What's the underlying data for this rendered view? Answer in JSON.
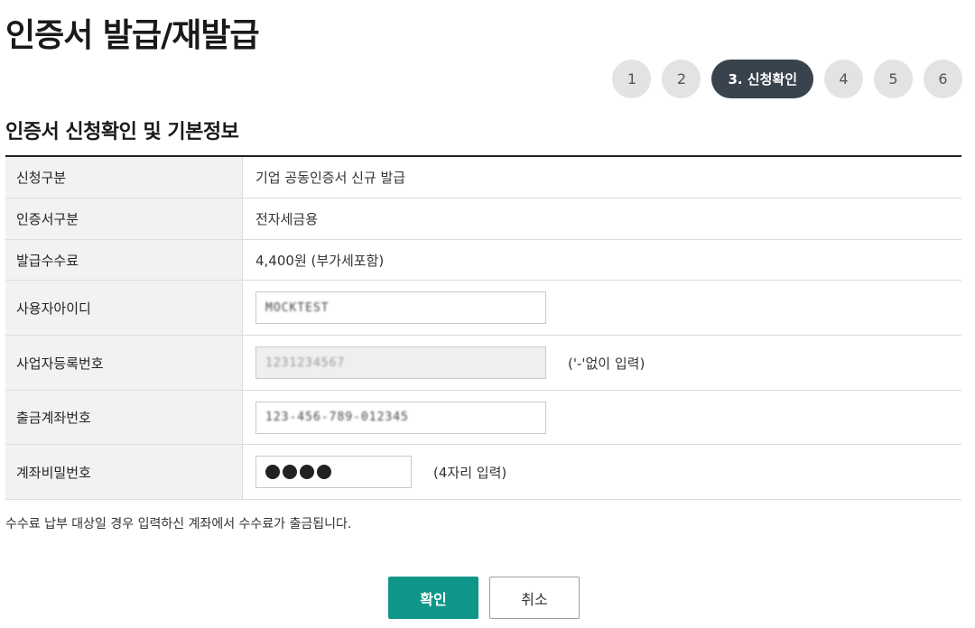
{
  "page": {
    "title": "인증서 발급/재발급"
  },
  "steps": [
    {
      "label": "1"
    },
    {
      "label": "2"
    },
    {
      "label": "3. 신청확인"
    },
    {
      "label": "4"
    },
    {
      "label": "5"
    },
    {
      "label": "6"
    }
  ],
  "section": {
    "title": "인증서 신청확인 및 기본정보"
  },
  "form": {
    "rows": [
      {
        "label": "신청구분",
        "value": "기업 공동인증서 신규 발급"
      },
      {
        "label": "인증서구분",
        "value": "전자세금용"
      },
      {
        "label": "발급수수료",
        "value": "4,400원 (부가세포함)"
      },
      {
        "label": "사용자아이디",
        "value": "MOCKTEST"
      },
      {
        "label": "사업자등록번호",
        "value": "1231234567",
        "hint": "('-'없이 입력)"
      },
      {
        "label": "출금계좌번호",
        "value": "123-456-789-012345"
      },
      {
        "label": "계좌비밀번호",
        "hint": "(4자리 입력)"
      }
    ]
  },
  "notice": "수수료 납부 대상일 경우 입력하신 계좌에서 수수료가 출금됩니다.",
  "buttons": {
    "confirm": "확인",
    "cancel": "취소"
  },
  "colors": {
    "active_step": "#39434d",
    "primary_button": "#0f9688",
    "label_bg": "#f1f2f4"
  }
}
